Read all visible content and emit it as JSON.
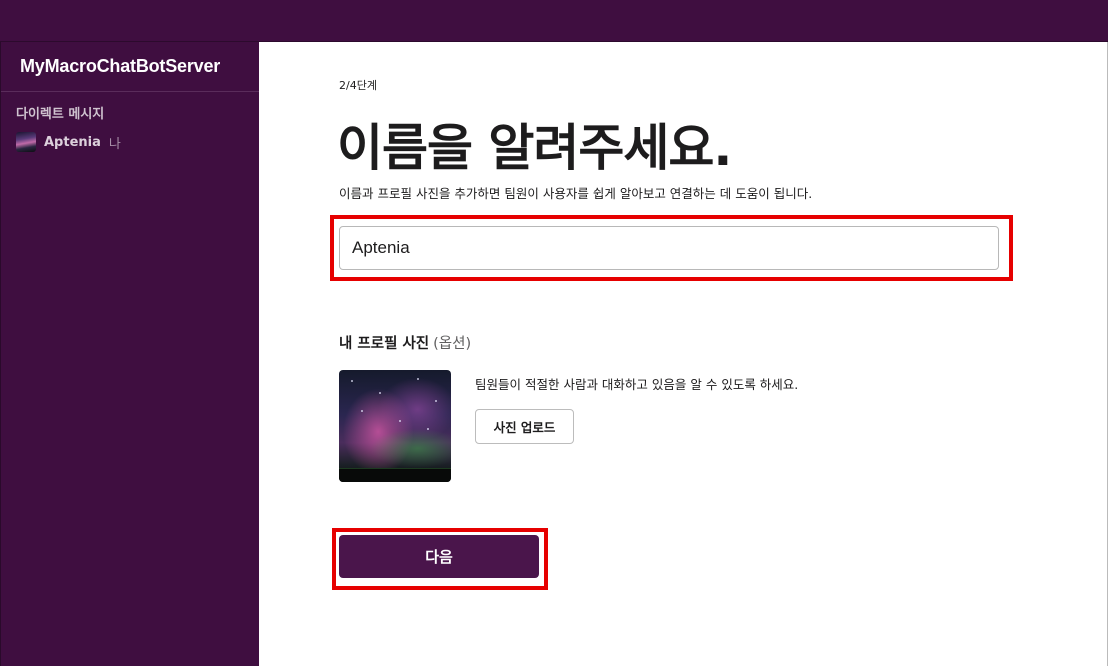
{
  "workspace": {
    "name": "MyMacroChatBotServer"
  },
  "sidebar": {
    "section_title": "다이렉트 메시지",
    "dm_items": [
      {
        "name": "Aptenia",
        "suffix": "나"
      }
    ]
  },
  "main": {
    "step": "2/4단계",
    "title": "이름을 알려주세요.",
    "subtitle": "이름과 프로필 사진을 추가하면 팀원이 사용자를 쉽게 알아보고 연결하는 데 도움이 됩니다.",
    "name_input": {
      "value": "Aptenia"
    },
    "photo_section": {
      "heading": "내 프로필 사진",
      "optional": "(옵션)",
      "description": "팀원들이 적절한 사람과 대화하고 있음을 알 수 있도록 하세요.",
      "upload_label": "사진 업로드"
    },
    "next_label": "다음"
  },
  "colors": {
    "sidebar_bg": "#3f0e40",
    "primary_button": "#4a154b",
    "highlight": "#e60000"
  }
}
